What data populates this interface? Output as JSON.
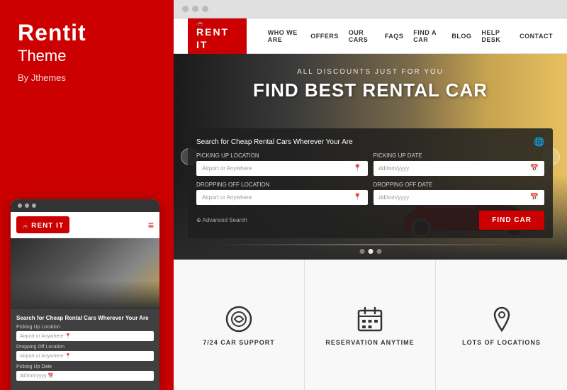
{
  "left": {
    "brand": "Rentit",
    "subtitle": "Theme",
    "by": "By Jthemes"
  },
  "mobile": {
    "logo": "RENT IT",
    "search_title": "Search for Cheap Rental Cars Wherever Your Are",
    "field1_label": "Picking Up Location",
    "field1_placeholder": "Airport or Anywhere",
    "field2_label": "Dropping Off Location",
    "field2_placeholder": "Airport or Anywhere",
    "field3_label": "Picking Up Date",
    "field3_placeholder": "dd/mm/yyyy"
  },
  "browser": {
    "dots": [
      "dot1",
      "dot2",
      "dot3"
    ]
  },
  "header": {
    "logo_text": "RENT IT",
    "nav": [
      "WHO WE ARE",
      "OFFERS",
      "OUR CARS",
      "FAQS",
      "FIND A CAR",
      "BLOG",
      "HELP DESK",
      "CONTACT"
    ]
  },
  "hero": {
    "subtitle": "ALL DISCOUNTS JUST FOR YOU",
    "title": "FIND BEST RENTAL CAR",
    "search_label": "Search for Cheap Rental Cars Wherever Your Are",
    "picking_up_location_label": "Picking Up Location",
    "picking_up_location_placeholder": "Airport or Anywhere",
    "picking_up_date_label": "Picking Up Date",
    "picking_up_date_placeholder": "dd/mm/yyyy",
    "dropping_off_location_label": "Dropping Off Location",
    "dropping_off_location_placeholder": "Airport or Anywhere",
    "dropping_off_date_label": "Dropping Off Date",
    "dropping_off_date_placeholder": "dd/mm/yyyy",
    "advanced_search": "Advanced Search",
    "find_car_btn": "FIND CAR",
    "dots": [
      1,
      2,
      3
    ],
    "active_dot": 1
  },
  "features": [
    {
      "icon": "support",
      "label": "7/24 CAR SUPPORT"
    },
    {
      "icon": "calendar",
      "label": "RESERVATION ANYTIME"
    },
    {
      "icon": "location",
      "label": "LOTS OF LOCATIONS"
    }
  ]
}
